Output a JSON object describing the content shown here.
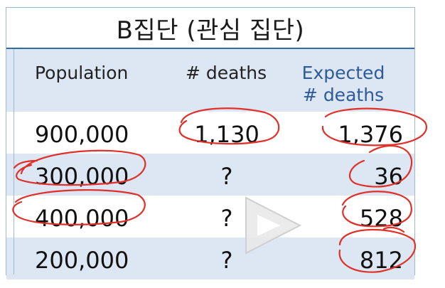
{
  "table": {
    "title": "B집단 (관심 집단)",
    "headers": {
      "population": "Population",
      "deaths": "# deaths",
      "expected_line1": "Expected",
      "expected_line2": "# deaths"
    },
    "rows": [
      {
        "population": "900,000",
        "deaths": "1,130",
        "expected": "1,376"
      },
      {
        "population": "300,000",
        "deaths": "?",
        "expected": "36"
      },
      {
        "population": "400,000",
        "deaths": "?",
        "expected": "528"
      },
      {
        "population": "200,000",
        "deaths": "?",
        "expected": "812"
      }
    ]
  },
  "colors": {
    "header_bg": "#dce7f3",
    "title_rule": "#2d6fa4",
    "expected_text": "#2e5a9a",
    "annotation_ink": "#e0302a"
  },
  "overlay": {
    "play_icon": "play-icon"
  }
}
